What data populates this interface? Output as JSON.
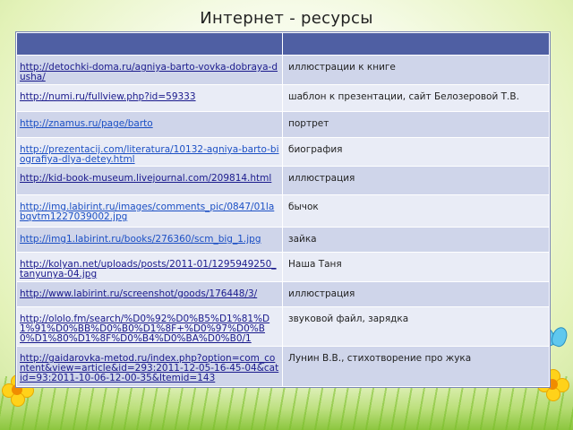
{
  "title": "Интернет - ресурсы",
  "table": {
    "rows": [
      {
        "url": "http://detochki-doma.ru/agniya-barto-vovka-dobraya-dusha/",
        "desc": "иллюстрации к книге"
      },
      {
        "url": "http://numi.ru/fullview.php?id=59333",
        "desc": "шаблон к презентации, сайт Белозеровой Т.В."
      },
      {
        "url": "http://znamus.ru/page/barto",
        "desc": "портрет"
      },
      {
        "url": "http://prezentacij.com/literatura/10132-agniya-barto-biografiya-dlya-detey.html",
        "desc": "биография"
      },
      {
        "url": "http://kid-book-museum.livejournal.com/209814.html",
        "desc": "иллюстрация"
      },
      {
        "url": "http://img.labirint.ru/images/comments_pic/0847/01labqvtm1227039002.jpg",
        "desc": "бычок"
      },
      {
        "url": "http://img1.labirint.ru/books/276360/scm_big_1.jpg",
        "desc": "зайка"
      },
      {
        "url": "http://kolyan.net/uploads/posts/2011-01/1295949250_tanyunya-04.jpg",
        "desc": "Наша Таня"
      },
      {
        "url": "http://www.labirint.ru/screenshot/goods/176448/3/",
        "desc": "иллюстрация"
      },
      {
        "url": "http://ololo.fm/search/%D0%92%D0%B5%D1%81%D1%91%D0%BB%D0%B0%D1%8F+%D0%97%D0%B0%D1%80%D1%8F%D0%B4%D0%BA%D0%B0/1",
        "desc": "звуковой файл, зарядка"
      },
      {
        "url": "http://gaidarovka-metod.ru/index.php?option=com_content&view=article&id=293:2011-12-05-16-45-04&catid=93:2011-10-06-12-00-35&Itemid=143",
        "desc": "Лунин В.В., стихотворение про жука"
      }
    ]
  }
}
